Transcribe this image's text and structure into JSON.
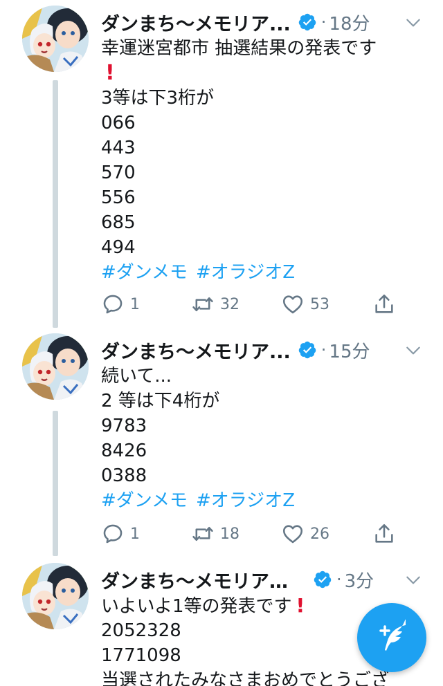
{
  "tweets": [
    {
      "author": "ダンまち～メモリア...",
      "time": "18分",
      "lines": [
        "幸運迷宮都市 抽選結果の発表です",
        "!",
        "3等は下3桁が",
        "066",
        "443",
        "570",
        "556",
        "685",
        "494"
      ],
      "hashtags": [
        "#ダンメモ",
        "#オラジオZ"
      ],
      "replies": "1",
      "retweets": "32",
      "likes": "53"
    },
    {
      "author": "ダンまち～メモリア...",
      "time": "15分",
      "lines": [
        "続いて...",
        "2 等は下4桁が",
        "9783",
        "8426",
        "0388"
      ],
      "hashtags": [
        "#ダンメモ",
        "#オラジオZ"
      ],
      "replies": "1",
      "retweets": "18",
      "likes": "26"
    },
    {
      "author": "ダンまち～メモリア・...",
      "time": "3分",
      "lines": [
        "いよいよ1等の発表です",
        "2052328",
        "1771098",
        "当選されたみなさまおめでとうござ"
      ]
    }
  ],
  "colors": {
    "accent": "#1da1f2",
    "muted": "#657786",
    "thread_line": "#cfd9de",
    "exclamation": "#e0102f"
  },
  "icons": {
    "verified": "verified-badge-icon",
    "caret": "chevron-down-icon",
    "reply": "reply-icon",
    "retweet": "retweet-icon",
    "like": "heart-icon",
    "share": "share-icon",
    "compose": "compose-tweet-icon"
  }
}
